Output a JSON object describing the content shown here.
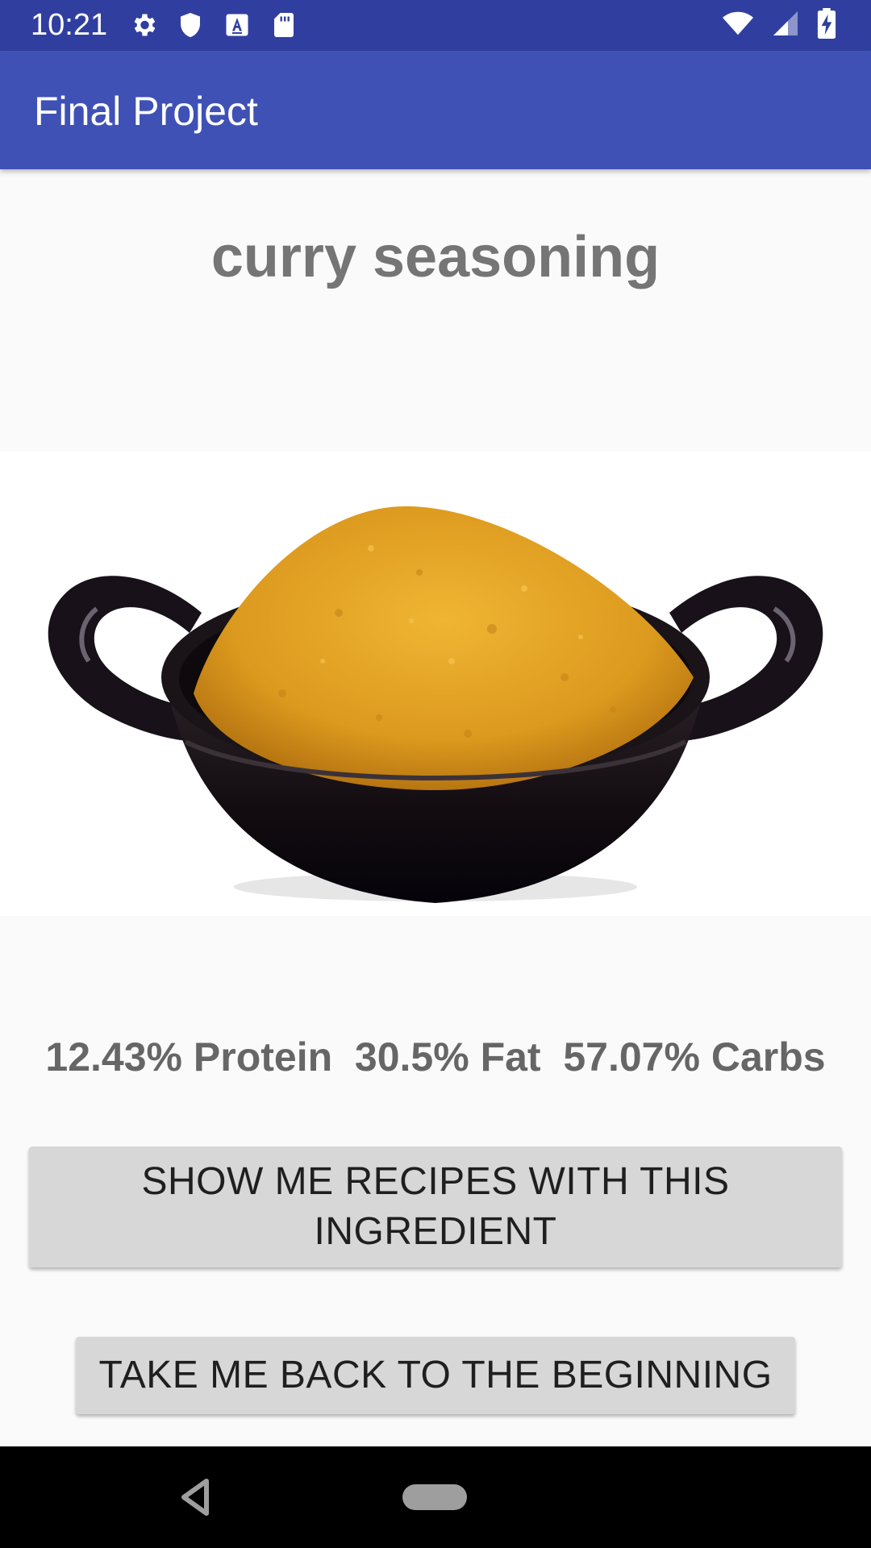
{
  "status_bar": {
    "time": "10:21",
    "icons_left": [
      "settings-icon",
      "shield-icon",
      "keyboard-a-icon",
      "sd-card-icon"
    ],
    "icons_right": [
      "wifi-icon",
      "signal-icon",
      "battery-charging-icon"
    ]
  },
  "app_bar": {
    "title": "Final Project"
  },
  "ingredient": {
    "name": "curry seasoning",
    "image_icon": "curry-bowl-image"
  },
  "macros": {
    "text": "12.43% Protein  30.5% Fat  57.07% Carbs"
  },
  "buttons": {
    "recipes_line1": "SHOW ME RECIPES WITH THIS",
    "recipes_line2": "INGREDIENT",
    "back": "TAKE ME BACK TO THE BEGINNING"
  },
  "nav_bar": {
    "icons": [
      "back-triangle-icon",
      "home-pill-icon"
    ]
  },
  "colors": {
    "status_bar": "#303f9f",
    "app_bar": "#3f51b5",
    "background": "#fafafa",
    "button": "#d7d7d7",
    "curry": "#e0a020"
  }
}
